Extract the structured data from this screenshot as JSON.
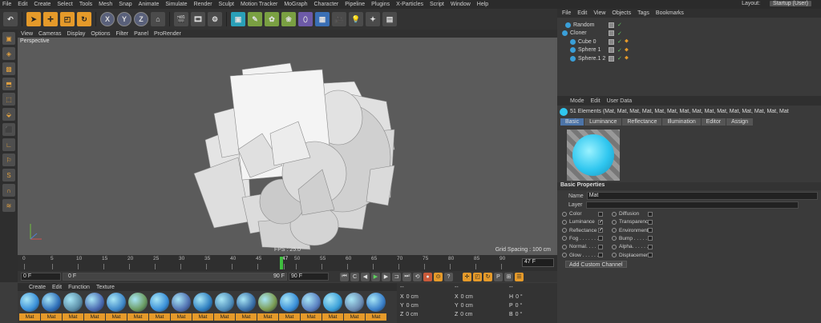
{
  "menubar": {
    "items": [
      "File",
      "Edit",
      "Create",
      "Select",
      "Tools",
      "Mesh",
      "Snap",
      "Animate",
      "Simulate",
      "Render",
      "Sculpt",
      "Motion Tracker",
      "MoGraph",
      "Character",
      "Pipeline",
      "Plugins",
      "X-Particles",
      "Script",
      "Window",
      "Help"
    ],
    "layout_label": "Layout:",
    "layout_value": "Startup (User)"
  },
  "toolbar": {
    "axis_x": "X",
    "axis_y": "Y",
    "axis_z": "Z"
  },
  "viewport": {
    "menu": [
      "View",
      "Cameras",
      "Display",
      "Options",
      "Filter",
      "Panel",
      "ProRender"
    ],
    "label": "Perspective",
    "fps": "FPS : 25.0",
    "grid": "Grid Spacing : 100 cm"
  },
  "timeline": {
    "ticks": [
      "0",
      "5",
      "10",
      "15",
      "20",
      "25",
      "30",
      "35",
      "40",
      "45",
      "47",
      "50",
      "55",
      "60",
      "65",
      "70",
      "75",
      "80",
      "85",
      "90"
    ],
    "current_frame": "47 F"
  },
  "playbar": {
    "start": "0 F",
    "start2": "0 F",
    "end": "90 F",
    "end2": "90 F"
  },
  "materials": {
    "menu": [
      "Create",
      "Edit",
      "Function",
      "Texture"
    ],
    "items": [
      "Mat",
      "Mat",
      "Mat",
      "Mat",
      "Mat",
      "Mat",
      "Mat",
      "Mat",
      "Mat",
      "Mat",
      "Mat",
      "Mat",
      "Mat",
      "Mat",
      "Mat",
      "Mat",
      "Mat"
    ]
  },
  "coords": {
    "header": [
      "--",
      "--",
      "--"
    ],
    "rows": [
      [
        {
          "k": "X",
          "v": "0 cm"
        },
        {
          "k": "X",
          "v": "0 cm"
        },
        {
          "k": "H",
          "v": "0 °"
        }
      ],
      [
        {
          "k": "Y",
          "v": "0 cm"
        },
        {
          "k": "Y",
          "v": "0 cm"
        },
        {
          "k": "P",
          "v": "0 °"
        }
      ],
      [
        {
          "k": "Z",
          "v": "0 cm"
        },
        {
          "k": "Z",
          "v": "0 cm"
        },
        {
          "k": "B",
          "v": "0 °"
        }
      ]
    ]
  },
  "objects": {
    "menu": [
      "File",
      "Edit",
      "View",
      "Objects",
      "Tags",
      "Bookmarks"
    ],
    "rows": [
      {
        "name": "Random",
        "indent": 6
      },
      {
        "name": "Cloner",
        "indent": 2
      },
      {
        "name": "Cube 0",
        "indent": 12
      },
      {
        "name": "Sphere 1",
        "indent": 12
      },
      {
        "name": "Sphere.1 2",
        "indent": 12
      }
    ]
  },
  "attributes": {
    "menu": [
      "Mode",
      "Edit",
      "User Data"
    ],
    "elements": "51 Elements (Mat, Mat, Mat, Mat, Mat, Mat, Mat, Mat, Mat, Mat, Mat, Mat, Mat, Mat, Mat",
    "tabs": [
      "Basic",
      "Luminance",
      "Reflectance",
      "Illumination",
      "Editor",
      "Assign"
    ],
    "section": "Basic Properties",
    "name_label": "Name",
    "name_value": "Mat",
    "layer_label": "Layer",
    "channels_left": [
      {
        "label": "Color",
        "checked": false
      },
      {
        "label": "Luminance",
        "checked": true
      },
      {
        "label": "Reflectance",
        "checked": true
      },
      {
        "label": "Fog . . . . . . .",
        "checked": false
      },
      {
        "label": "Normal. . . . .",
        "checked": false
      },
      {
        "label": "Glow . . . . . .",
        "checked": false
      }
    ],
    "channels_right": [
      {
        "label": "Diffusion",
        "checked": false
      },
      {
        "label": "Transparency",
        "checked": false
      },
      {
        "label": "Environment",
        "checked": false
      },
      {
        "label": "Bump . . . . . .",
        "checked": false
      },
      {
        "label": "Alpha. . . . . .",
        "checked": false
      },
      {
        "label": "Displacement",
        "checked": false
      }
    ],
    "add_channel": "Add Custom Channel"
  }
}
